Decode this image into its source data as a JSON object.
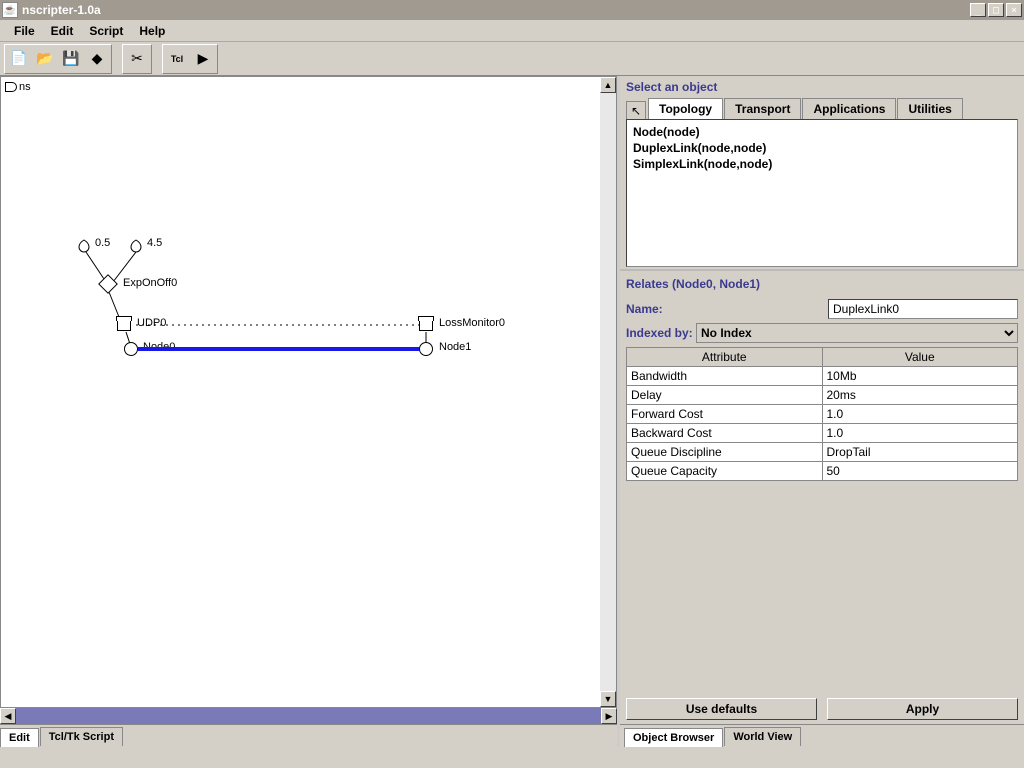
{
  "window": {
    "title": "nscripter-1.0a"
  },
  "menu": {
    "file": "File",
    "edit": "Edit",
    "script": "Script",
    "help": "Help"
  },
  "canvas": {
    "root_label": "ns",
    "anno_05": "0.5",
    "anno_45": "4.5",
    "exp": "ExpOnOff0",
    "udp": "UDP0",
    "node0": "Node0",
    "lossmon": "LossMonitor0",
    "node1": "Node1"
  },
  "left_tabs": {
    "edit": "Edit",
    "tcl": "Tcl/Tk Script"
  },
  "select": {
    "title": "Select an object",
    "tabs": {
      "topology": "Topology",
      "transport": "Transport",
      "applications": "Applications",
      "utilities": "Utilities"
    },
    "items": {
      "a": "Node(node)",
      "b": "DuplexLink(node,node)",
      "c": "SimplexLink(node,node)"
    }
  },
  "relates": {
    "title": "Relates (Node0, Node1)",
    "name_label": "Name:",
    "name_value": "DuplexLink0",
    "indexed_label": "Indexed by:",
    "indexed_value": "No Index",
    "headers": {
      "attr": "Attribute",
      "val": "Value"
    },
    "rows": [
      {
        "attr": "Bandwidth",
        "val": "10Mb"
      },
      {
        "attr": "Delay",
        "val": "20ms"
      },
      {
        "attr": "Forward Cost",
        "val": "1.0"
      },
      {
        "attr": "Backward Cost",
        "val": "1.0"
      },
      {
        "attr": "Queue Discipline",
        "val": "DropTail"
      },
      {
        "attr": "Queue Capacity",
        "val": "50"
      }
    ]
  },
  "buttons": {
    "defaults": "Use defaults",
    "apply": "Apply"
  },
  "right_tabs": {
    "browser": "Object Browser",
    "world": "World View"
  }
}
